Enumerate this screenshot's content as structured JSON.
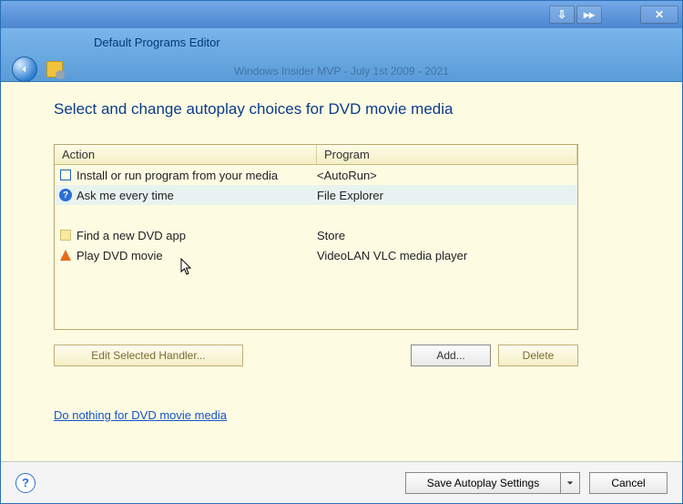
{
  "titlebar": {
    "pin": "⇩",
    "handle": "▸▸",
    "close": "✕"
  },
  "header": {
    "app_title": "Default Programs Editor",
    "watermark": "Windows Insider MVP - July 1st 2009 - 2021"
  },
  "heading": "Select and change autoplay choices for DVD movie media",
  "columns": {
    "action": "Action",
    "program": "Program"
  },
  "rows": [
    {
      "action": "Install or run program from your media",
      "program": "<AutoRun>"
    },
    {
      "action": "Ask me every time",
      "program": "File Explorer"
    },
    {
      "action": "Find a new DVD app",
      "program": "Store"
    },
    {
      "action": "Play DVD movie",
      "program": "VideoLAN VLC media player"
    }
  ],
  "buttons": {
    "edit": "Edit Selected Handler...",
    "add": "Add...",
    "delete": "Delete"
  },
  "link": "Do nothing for DVD movie media",
  "footer": {
    "help": "?",
    "save": "Save Autoplay Settings",
    "cancel": "Cancel"
  }
}
